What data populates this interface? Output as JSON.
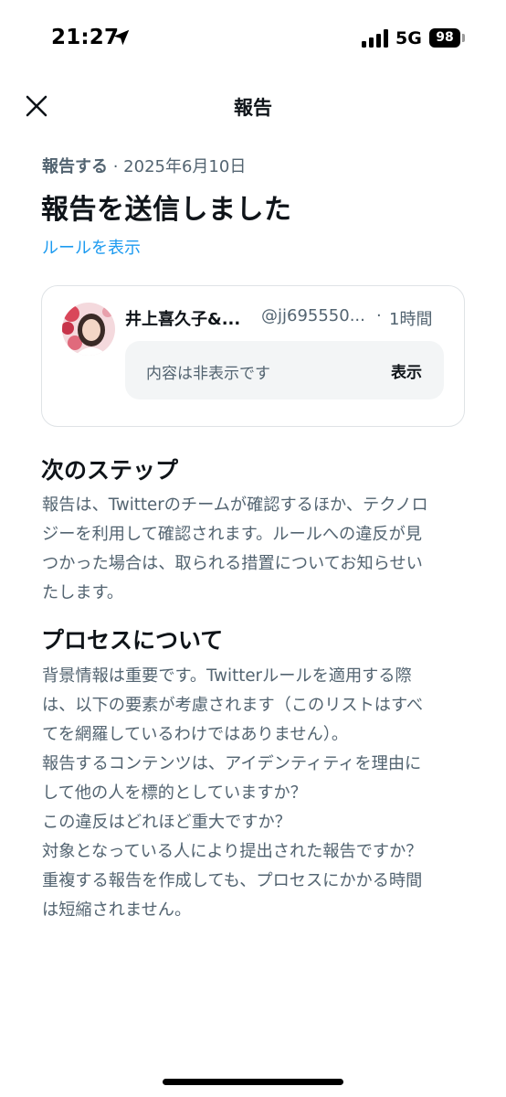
{
  "status_bar": {
    "time": "21:27",
    "network": "5G",
    "battery": "98"
  },
  "header": {
    "title": "報告"
  },
  "report": {
    "meta_label": "報告する",
    "meta_separator": " · ",
    "meta_date": "2025年6月10日",
    "title": "報告を送信しました",
    "rules_link": "ルールを表示"
  },
  "tweet": {
    "author": "井上喜久子&...",
    "handle": "@jj695550...",
    "separator": "·",
    "time": "1時間",
    "hidden_text": "内容は非表示です",
    "show_label": "表示"
  },
  "next_steps": {
    "heading": "次のステップ",
    "lines": [
      "報告は、Twitterのチームが確認するほか、テクノロ",
      "ジーを利用して確認されます。ルールへの違反が見",
      "つかった場合は、取られる措置についてお知らせい",
      "たします。"
    ]
  },
  "process": {
    "heading": "プロセスについて",
    "lines": [
      "背景情報は重要です。Twitterルールを適用する際",
      "は、以下の要素が考慮されます（このリストはすべ",
      "てを網羅しているわけではありません）。",
      "報告するコンテンツは、アイデンティティを理由に",
      "して他の人を標的としていますか？",
      "この違反はどれほど重大ですか？",
      "対象となっている人により提出された報告ですか？",
      "重複する報告を作成しても、プロセスにかかる時間",
      "は短縮されません。"
    ]
  },
  "colors": {
    "text_primary": "#0f1419",
    "text_secondary": "#536471",
    "link": "#1d9bf0",
    "card_border": "#dfe3e6",
    "hidden_bg": "#f3f5f6"
  },
  "icons": [
    "location-arrow-icon",
    "cellular-signal-icon",
    "battery-icon",
    "close-icon",
    "avatar"
  ]
}
